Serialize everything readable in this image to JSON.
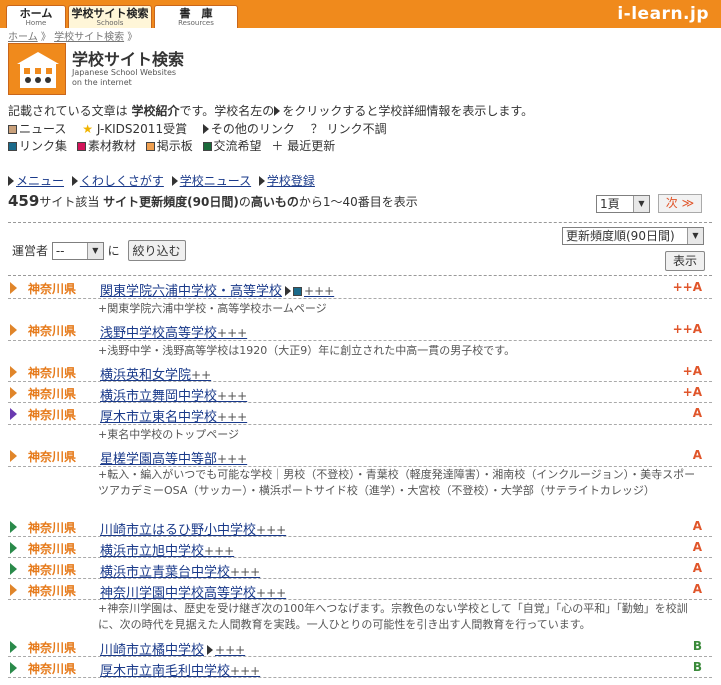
{
  "tabs": [
    {
      "label": "ホーム",
      "sub": "Home"
    },
    {
      "label": "学校サイト検索",
      "sub": "Schools"
    },
    {
      "label": "書　庫",
      "sub": "Resources"
    }
  ],
  "brand": "i-learn.jp",
  "breadcrumb": {
    "home": "ホーム",
    "sep": "》",
    "current": "学校サイト検索"
  },
  "logo": {
    "title": "学校サイト検索",
    "sub1": "Japanese School Websites",
    "sub2": "on the internet"
  },
  "intro": {
    "pre": "記載されている文章は",
    "bold": "学校紹介",
    "post": "です。学校名左の",
    "post2": "をクリックすると学校詳細情報を表示します。"
  },
  "legend": {
    "news": "ニュース",
    "award": "J-KIDS2011受賞",
    "other": "その他のリンク",
    "broken_mark": "？",
    "broken": "リンク不調",
    "links": "リンク集",
    "materials": "素材教材",
    "board": "掲示板",
    "exchange": "交流希望",
    "new_mark": "＋",
    "recent": "最近更新"
  },
  "navlinks": [
    "メニュー",
    "くわしくさがす",
    "学校ニュース",
    "学校登録"
  ],
  "count": {
    "num": "459",
    "unit": "サイト該当",
    "bold": "サイト更新頻度(90日間)",
    "mid": "の",
    "bold2": "高いもの",
    "post": "から1〜40番目を表示"
  },
  "pager": {
    "page": "1頁",
    "next": "次 ≫"
  },
  "sort": {
    "selected": "更新頻度順(90日間)",
    "show": "表示"
  },
  "operator": {
    "label": "運営者",
    "selected": "--",
    "ni": "に",
    "filter": "絞り込む"
  },
  "colors": {
    "accent": "#f08a1c",
    "link": "#1a3a8a",
    "rank": "#e0552a",
    "rankB": "#3a8a3a"
  },
  "rows": [
    {
      "pref": "神奈川県",
      "name": "関東学院六浦中学校・高等学校",
      "after": "+++",
      "rank": "++A",
      "desc": "+関東学院六浦中学校・高等学校ホームページ"
    },
    {
      "pref": "神奈川県",
      "name": "浅野中学校高等学校",
      "after": "+++",
      "rank": "++A",
      "desc": "+浅野中学・浅野高等学校は1920（大正9）年に創立された中高一貫の男子校です。"
    },
    {
      "pref": "神奈川県",
      "name": "横浜英和女学院",
      "after": "++",
      "rank": "+A",
      "desc": ""
    },
    {
      "pref": "神奈川県",
      "name": "横浜市立舞岡中学校",
      "after": "+++",
      "rank": "+A",
      "desc": ""
    },
    {
      "pref": "神奈川県",
      "name": "厚木市立東名中学校",
      "after": "+++",
      "rank": "A",
      "desc": "+東名中学校のトップページ"
    },
    {
      "pref": "神奈川県",
      "name": "星槎学園高等中等部",
      "after": "+++",
      "rank": "A",
      "desc": "+転入・編入がいつでも可能な学校｜男校（不登校）・青葉校（軽度発達障害）・湘南校（インクルージョン）・美寺スポーツアカデミーOSA（サッカー）・横浜ポートサイド校（進学）・大宮校（不登校）・大学部（サテライトカレッジ）"
    },
    {
      "pref": "神奈川県",
      "name": "川崎市立はるひ野小中学校",
      "after": "+++",
      "rank": "A",
      "desc": ""
    },
    {
      "pref": "神奈川県",
      "name": "横浜市立旭中学校",
      "after": "+++",
      "rank": "A",
      "desc": ""
    },
    {
      "pref": "神奈川県",
      "name": "横浜市立青葉台中学校",
      "after": "+++",
      "rank": "A",
      "desc": ""
    },
    {
      "pref": "神奈川県",
      "name": "神奈川学園中学校高等学校",
      "after": "+++",
      "rank": "A",
      "desc": "+神奈川学園は、歴史を受け継ぎ次の100年へつなげます。宗教色のない学校として「自覚」「心の平和」「勤勉」を校訓に、次の時代を見据えた人間教育を実践。一人ひとりの可能性を引き出す人間教育を行っています。"
    },
    {
      "pref": "神奈川県",
      "name": "川崎市立橘中学校",
      "after": "+++",
      "rank": "B",
      "desc": ""
    },
    {
      "pref": "神奈川県",
      "name": "厚木市立南毛利中学校",
      "after": "+++",
      "rank": "B",
      "desc": ""
    }
  ]
}
